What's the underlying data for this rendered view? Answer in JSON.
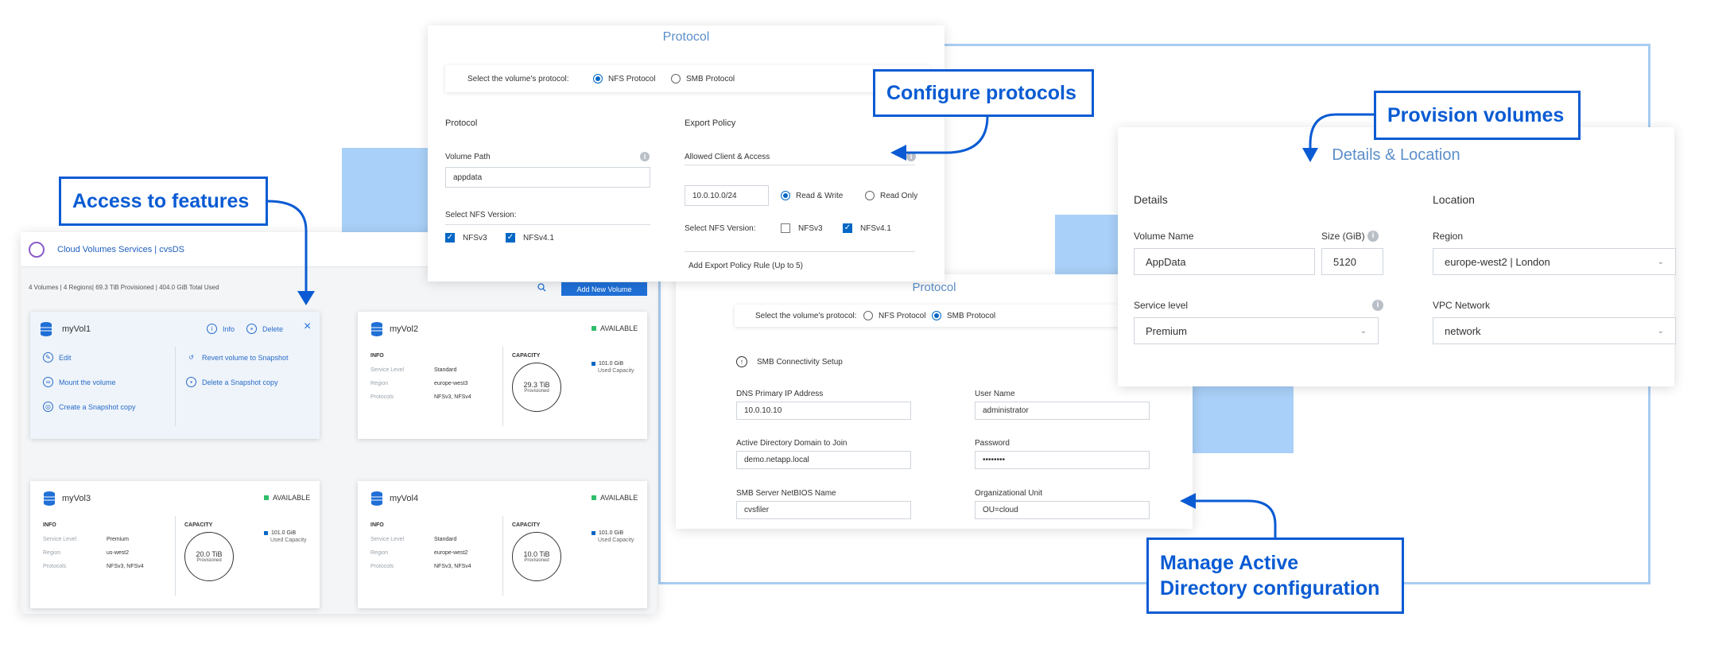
{
  "callouts": {
    "access": "Access to features",
    "configure": "Configure protocols",
    "provision": "Provision volumes",
    "manage_line1": "Manage Active",
    "manage_line2": "Directory configuration"
  },
  "dashboard": {
    "title": "Cloud Volumes Services | cvsDS",
    "summary": "4 Volumes | 4 Regions| 69.3 TiB Provisioned | 404.0 GiB Total Used",
    "add_button": "Add New Volume",
    "vol1": {
      "name": "myVol1",
      "info": "Info",
      "delete": "Delete",
      "actions": [
        "Edit",
        "Mount the volume",
        "Create a Snapshot copy",
        "Revert volume to Snapshot",
        "Delete a Snapshot copy"
      ]
    },
    "info_heading": "INFO",
    "capacity_heading": "CAPACITY",
    "row_labels": [
      "Service Level",
      "Region",
      "Protocols"
    ],
    "status": "AVAILABLE",
    "used": "101.0 GiB",
    "used_label": "Used Capacity",
    "provisioned_label": "Provisioned",
    "vol2": {
      "name": "myVol2",
      "service": "Standard",
      "region": "europe-west3",
      "protocols": "NFSv3, NFSv4",
      "capacity": "29.3 TiB"
    },
    "vol3": {
      "name": "myVol3",
      "service": "Premium",
      "region": "us-west2",
      "protocols": "NFSv3, NFSv4",
      "capacity": "20.0 TiB"
    },
    "vol4": {
      "name": "myVol4",
      "service": "Standard",
      "region": "europe-west2",
      "protocols": "NFSv3, NFSv4",
      "capacity": "10.0 TiB"
    }
  },
  "nfs": {
    "title": "Protocol",
    "select_label": "Select the volume's protocol:",
    "opt_nfs": "NFS Protocol",
    "opt_smb": "SMB Protocol",
    "protocol_heading": "Protocol",
    "volume_path_label": "Volume Path",
    "volume_path_value": "appdata",
    "nfs_version_label": "Select NFS Version:",
    "nfsv3": "NFSv3",
    "nfsv41": "NFSv4.1",
    "export_heading": "Export Policy",
    "allowed_label": "Allowed Client & Access",
    "client_value": "10.0.10.0/24",
    "read_write": "Read & Write",
    "read_only": "Read Only",
    "add_rule": "Add Export Policy Rule (Up to 5)"
  },
  "smb": {
    "title": "Protocol",
    "select_label": "Select the volume's protocol:",
    "opt_nfs": "NFS Protocol",
    "opt_smb": "SMB Protocol",
    "setup": "SMB Connectivity Setup",
    "dns_label": "DNS Primary IP Address",
    "dns_value": "10.0.10.10",
    "user_label": "User Name",
    "user_value": "administrator",
    "domain_label": "Active Directory Domain to Join",
    "domain_value": "demo.netapp.local",
    "password_label": "Password",
    "password_value": "••••••••",
    "netbios_label": "SMB Server NetBIOS Name",
    "netbios_value": "cvsfiler",
    "ou_label": "Organizational Unit",
    "ou_value": "OU=cloud"
  },
  "details": {
    "title": "Details & Location",
    "details_heading": "Details",
    "location_heading": "Location",
    "volume_name_label": "Volume Name",
    "volume_name_value": "AppData",
    "size_label": "Size (GiB)",
    "size_value": "5120",
    "region_label": "Region",
    "region_value": "europe-west2 | London",
    "service_label": "Service level",
    "service_value": "Premium",
    "vpc_label": "VPC Network",
    "vpc_value": "network"
  },
  "colors": {
    "accent": "#0a5bd3",
    "light_blue": "#a9d0f8",
    "available": "#2ebd6b"
  }
}
